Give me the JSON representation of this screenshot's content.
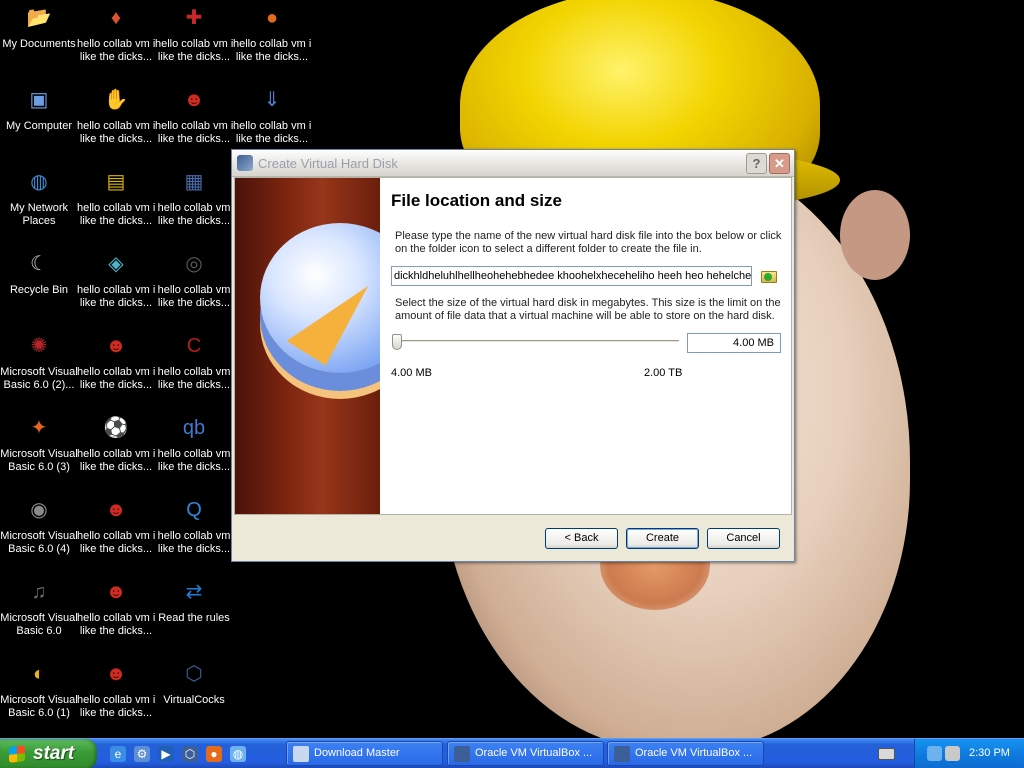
{
  "desktop": {
    "icons": [
      {
        "label1": "My Documents",
        "label2": "",
        "icon": "folder-icon",
        "glyph": "📂",
        "color": "#f0c84a"
      },
      {
        "label1": "hello collab vm i",
        "label2": "like the dicks...",
        "icon": "shortcut-app-icon",
        "glyph": "♦",
        "color": "#d9532b"
      },
      {
        "label1": "hello collab vm i",
        "label2": "like the dicks...",
        "icon": "shortcut-app-icon",
        "glyph": "✚",
        "color": "#c8282b"
      },
      {
        "label1": "hello collab vm i",
        "label2": "like the dicks...",
        "icon": "firefox-icon",
        "glyph": "●",
        "color": "#e46a1c"
      },
      {
        "label1": "My Computer",
        "label2": "",
        "icon": "computer-icon",
        "glyph": "▣",
        "color": "#6a9fe2"
      },
      {
        "label1": "hello collab vm i",
        "label2": "like the dicks...",
        "icon": "hand-icon",
        "glyph": "✋",
        "color": "#f5dc00"
      },
      {
        "label1": "hello collab vm i",
        "label2": "like the dicks...",
        "icon": "mario-icon",
        "glyph": "☻",
        "color": "#cf2a22"
      },
      {
        "label1": "hello collab vm i",
        "label2": "like the dicks...",
        "icon": "shortcut-app-icon",
        "glyph": "⇓",
        "color": "#4d7cc9"
      },
      {
        "label1": "My Network",
        "label2": "Places",
        "icon": "network-icon",
        "glyph": "◍",
        "color": "#3f8fd6"
      },
      {
        "label1": "hello collab vm i",
        "label2": "like the dicks...",
        "icon": "sm2-icon",
        "glyph": "▤",
        "color": "#d7b312"
      },
      {
        "label1": "hello collab vm",
        "label2": "like the dicks...",
        "icon": "film-icon",
        "glyph": "▦",
        "color": "#496aa8"
      },
      {
        "label1": "",
        "label2": "",
        "icon": "",
        "glyph": "",
        "color": ""
      },
      {
        "label1": "Recycle Bin",
        "label2": "",
        "icon": "moon-icon",
        "glyph": "☾",
        "color": "#cfcfcf"
      },
      {
        "label1": "hello collab vm i",
        "label2": "like the dicks...",
        "icon": "shortcut-app-icon",
        "glyph": "◈",
        "color": "#4bb4c9"
      },
      {
        "label1": "hello collab vm",
        "label2": "like the dicks...",
        "icon": "shortcut-app-icon",
        "glyph": "◎",
        "color": "#5a5a5a"
      },
      {
        "label1": "",
        "label2": "",
        "icon": "",
        "glyph": "",
        "color": ""
      },
      {
        "label1": "Microsoft Visual",
        "label2": "Basic 6.0 (2)...",
        "icon": "vb-icon",
        "glyph": "✺",
        "color": "#b3262b"
      },
      {
        "label1": "hello collab vm i",
        "label2": "like the dicks...",
        "icon": "mario-icon",
        "glyph": "☻",
        "color": "#d02b22"
      },
      {
        "label1": "hello collab vm",
        "label2": "like the dicks...",
        "icon": "shortcut-app-icon",
        "glyph": "C",
        "color": "#b31d1d"
      },
      {
        "label1": "",
        "label2": "",
        "icon": "",
        "glyph": "",
        "color": ""
      },
      {
        "label1": "Microsoft Visual",
        "label2": "Basic 6.0 (3)",
        "icon": "vb-icon",
        "glyph": "✦",
        "color": "#e6611f"
      },
      {
        "label1": "hello collab vm i",
        "label2": "like the dicks...",
        "icon": "soccer-icon",
        "glyph": "⚽",
        "color": "#3b8c3a"
      },
      {
        "label1": "hello collab vm",
        "label2": "like the dicks...",
        "icon": "qbittorrent-icon",
        "glyph": "qb",
        "color": "#3f79cf"
      },
      {
        "label1": "",
        "label2": "",
        "icon": "",
        "glyph": "",
        "color": ""
      },
      {
        "label1": "Microsoft Visual",
        "label2": "Basic 6.0 (4)",
        "icon": "raccoon-icon",
        "glyph": "◉",
        "color": "#8a8a8a"
      },
      {
        "label1": "hello collab vm i",
        "label2": "like the dicks...",
        "icon": "mario-icon",
        "glyph": "☻",
        "color": "#d02b22"
      },
      {
        "label1": "hello collab vm",
        "label2": "like the dicks...",
        "icon": "quicktime-icon",
        "glyph": "Q",
        "color": "#2f86d6"
      },
      {
        "label1": "",
        "label2": "",
        "icon": "",
        "glyph": "",
        "color": ""
      },
      {
        "label1": "Microsoft Visual",
        "label2": "Basic 6.0",
        "icon": "vb-icon",
        "glyph": "♫",
        "color": "#6a6a6a"
      },
      {
        "label1": "hello collab vm i",
        "label2": "like the dicks...",
        "icon": "mario-icon",
        "glyph": "☻",
        "color": "#d02b22"
      },
      {
        "label1": "Read the rules",
        "label2": "",
        "icon": "teamviewer-icon",
        "glyph": "⇄",
        "color": "#1e7fd9"
      },
      {
        "label1": "",
        "label2": "",
        "icon": "",
        "glyph": "",
        "color": ""
      },
      {
        "label1": "Microsoft Visual",
        "label2": "Basic 6.0 (1)",
        "icon": "vb-icon",
        "glyph": "◐",
        "color": "#e6b21f"
      },
      {
        "label1": "hello collab vm i",
        "label2": "like the dicks...",
        "icon": "mario-icon",
        "glyph": "☻",
        "color": "#d02b22"
      },
      {
        "label1": "VirtualCocks",
        "label2": "",
        "icon": "virtualbox-icon",
        "glyph": "⬡",
        "color": "#3c5f97"
      }
    ]
  },
  "dialog": {
    "title": "Create Virtual Hard Disk",
    "help_glyph": "?",
    "close_glyph": "✕",
    "heading": "File location and size",
    "location_desc": "Please type the name of the new virtual hard disk file into the box below or click on the folder icon to select a different folder to create the file in.",
    "location_value": "dickhldheluhlhellheohehebhedee khoohelxheceheliho heeh heo hehelchehe",
    "size_desc": "Select the size of the virtual hard disk in megabytes. This size is the limit on the amount of file data that a virtual machine will be able to store on the hard disk.",
    "size_value": "4.00 MB",
    "slider_fraction": 0.0,
    "range_min": "4.00 MB",
    "range_max": "2.00 TB",
    "back_label": "< Back",
    "create_label": "Create",
    "cancel_label": "Cancel"
  },
  "taskbar": {
    "start_label": "start",
    "quick_launch": [
      {
        "icon": "ie-icon",
        "color": "#3b8ee6",
        "glyph": "e"
      },
      {
        "icon": "settings-icon",
        "color": "#5c8fd6",
        "glyph": "⚙"
      },
      {
        "icon": "media-player-icon",
        "color": "#1f5fb5",
        "glyph": "▶"
      },
      {
        "icon": "virtualbox-icon",
        "color": "#3c5f97",
        "glyph": "⬡"
      },
      {
        "icon": "firefox-icon",
        "color": "#e46a1c",
        "glyph": "●"
      },
      {
        "icon": "network-icon",
        "color": "#6db2ef",
        "glyph": "◍"
      }
    ],
    "tasks": [
      {
        "label": "Download Master",
        "icon": "download-icon",
        "color": "#c9d8ef"
      },
      {
        "label": "Oracle VM VirtualBox ...",
        "icon": "virtualbox-icon",
        "color": "#3c5f97"
      },
      {
        "label": "Oracle VM VirtualBox ...",
        "icon": "virtualbox-icon",
        "color": "#3c5f97"
      }
    ],
    "clock": "2:30 PM"
  },
  "colors": {
    "dialog_bg": "#ece9d8",
    "taskbar": "#245ee0",
    "start": "#3a9b36",
    "button_border": "#003c74"
  }
}
